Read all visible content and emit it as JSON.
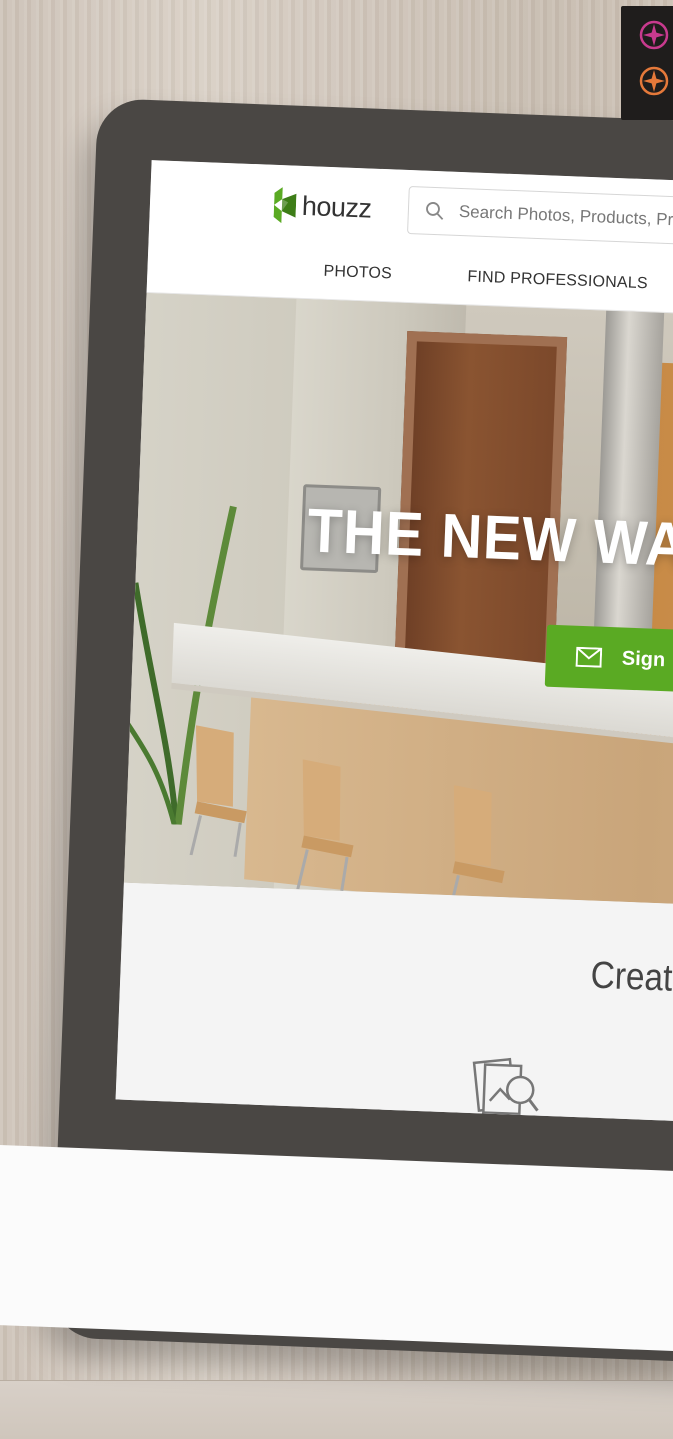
{
  "header": {
    "logo_text": "houzz",
    "search_placeholder": "Search Photos, Products, Pros",
    "nav": [
      "PHOTOS",
      "FIND PROFESSIONALS"
    ]
  },
  "hero": {
    "title": "THE NEW WA",
    "signup_label": "Sign"
  },
  "lower": {
    "headline": "Create th"
  },
  "icons": {
    "badge_top": "compass-icon",
    "badge_bottom": "compass-icon",
    "search": "search-icon",
    "mail": "mail-icon",
    "ideabook": "ideabook-icon"
  },
  "colors": {
    "brand_green": "#5aaa23",
    "badge_top_color": "#c83a8e",
    "badge_bottom_color": "#e5793a",
    "badge_bg": "#1f1d1c"
  }
}
